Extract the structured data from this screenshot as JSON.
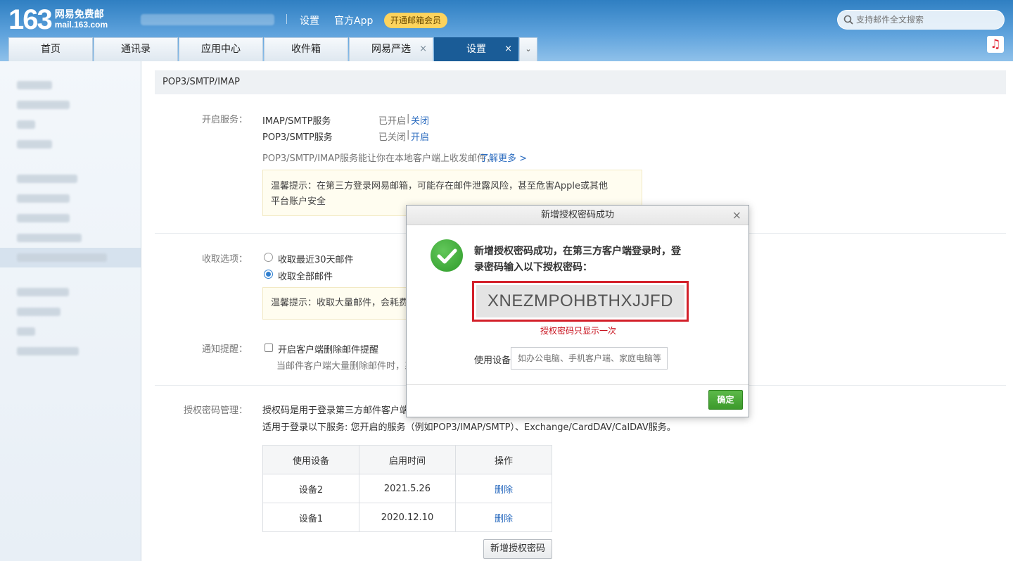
{
  "header": {
    "logo_number": "163",
    "logo_line1": "网易免费邮",
    "logo_line2": "mail.163.com",
    "links": [
      "设置",
      "官方App"
    ],
    "vip_label": "开通邮箱会员",
    "search_placeholder": "支持邮件全文搜索"
  },
  "tabs": [
    {
      "label": "首页",
      "closable": false,
      "active": false
    },
    {
      "label": "通讯录",
      "closable": false,
      "active": false
    },
    {
      "label": "应用中心",
      "closable": false,
      "active": false
    },
    {
      "label": "收件箱",
      "closable": false,
      "active": false
    },
    {
      "label": "网易严选",
      "closable": true,
      "active": false
    },
    {
      "label": "设置",
      "closable": true,
      "active": true
    }
  ],
  "tab_close_glyph": "×",
  "tab_more_glyph": "⌄",
  "section": {
    "title": "POP3/SMTP/IMAP",
    "service_label": "开启服务：",
    "services": [
      {
        "name": "IMAP/SMTP服务",
        "status": "已开启",
        "action": "关闭"
      },
      {
        "name": "POP3/SMTP服务",
        "status": "已关闭",
        "action": "开启"
      }
    ],
    "desc": "POP3/SMTP/IMAP服务能让你在本地客户端上收发邮件，",
    "learn_more": "了解更多 >",
    "warn_line1": "温馨提示：在第三方登录网易邮箱，可能存在邮件泄露风险，甚至危害Apple或其他",
    "warn_line2": "平台账户安全",
    "receive_label": "收取选项：",
    "receive_options": [
      "收取最近30天邮件",
      "收取全部邮件"
    ],
    "receive_selected": 1,
    "receive_hint": "温馨提示：收取大量邮件，会耗费您",
    "notify_label": "通知提醒：",
    "notify_option": "开启客户端删除邮件提醒",
    "notify_desc": "当邮件客户端大量删除邮件时，系统",
    "auth_label": "授权密码管理：",
    "auth_desc1": "授权码是用于登录第三方邮件客户端的",
    "auth_desc2": "适用于登录以下服务: 您开启的服务（例如POP3/IMAP/SMTP）、Exchange/CardDAV/CalDAV服务。",
    "table_headers": [
      "使用设备",
      "启用时间",
      "操作"
    ],
    "table_rows": [
      {
        "device": "设备2",
        "time": "2021.5.26",
        "action": "删除"
      },
      {
        "device": "设备1",
        "time": "2020.12.10",
        "action": "删除"
      }
    ],
    "add_button": "新增授权密码"
  },
  "modal": {
    "title": "新增授权密码成功",
    "close_glyph": "×",
    "message": "新增授权密码成功，在第三方客户端登录时，登录密码输入以下授权密码：",
    "code": "XNEZMPOHBTHXJJFD",
    "once_note": "授权密码只显示一次",
    "device_label": "使用设备",
    "device_placeholder": "如办公电脑、手机客户端、家庭电脑等",
    "ok_button": "确定"
  },
  "colors": {
    "header_blue": "#2f7fc2",
    "active_tab": "#1a5c97",
    "link": "#2a6bbf",
    "success_green": "#3c9a2b",
    "alert_red": "#d3202a",
    "vip_yellow": "#fdd35d"
  }
}
